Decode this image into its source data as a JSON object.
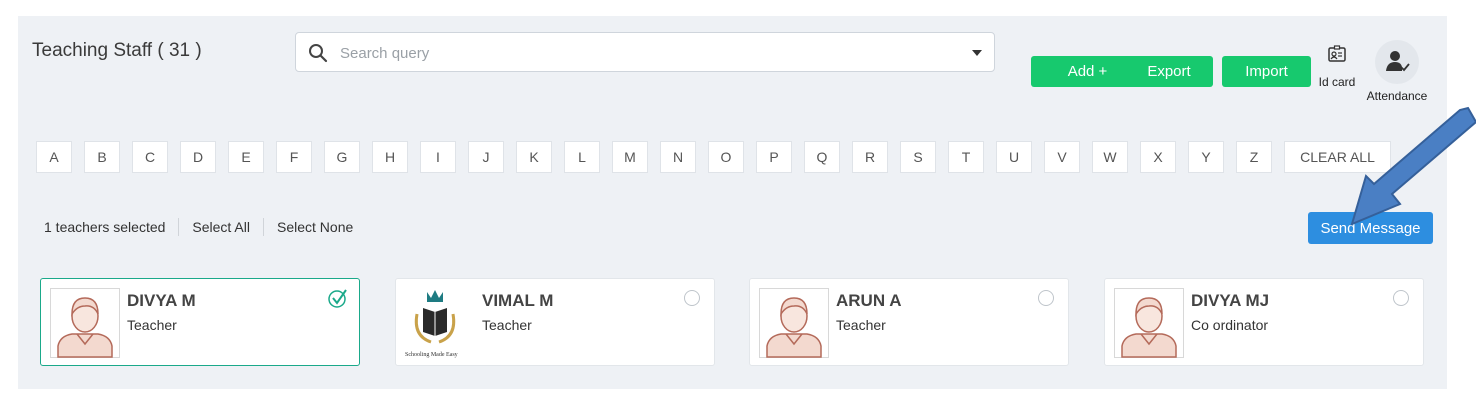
{
  "header": {
    "title": "Teaching Staff ( 31 )",
    "search_placeholder": "Search query",
    "buttons": {
      "add": "Add +",
      "export": "Export",
      "import": "Import"
    },
    "tools": {
      "id_card": "Id card",
      "attendance": "Attendance"
    }
  },
  "alphabet": [
    "A",
    "B",
    "C",
    "D",
    "E",
    "F",
    "G",
    "H",
    "I",
    "J",
    "K",
    "L",
    "M",
    "N",
    "O",
    "P",
    "Q",
    "R",
    "S",
    "T",
    "U",
    "V",
    "W",
    "X",
    "Y",
    "Z"
  ],
  "clear_all": "CLEAR ALL",
  "selection": {
    "count_text": "1 teachers selected",
    "select_all": "Select All",
    "select_none": "Select None",
    "send_message": "Send Message"
  },
  "staff": [
    {
      "name": "DIVYA M",
      "role": "Teacher",
      "selected": true,
      "avatar": "person-avatar"
    },
    {
      "name": "VIMAL M",
      "role": "Teacher",
      "selected": false,
      "avatar": "school-logo",
      "logo_text": "Schooling Made Easy"
    },
    {
      "name": "ARUN A",
      "role": "Teacher",
      "selected": false,
      "avatar": "person-avatar"
    },
    {
      "name": "DIVYA MJ",
      "role": "Co ordinator",
      "selected": false,
      "avatar": "person-avatar"
    }
  ],
  "colors": {
    "green": "#17c96e",
    "blue": "#2d8ee0",
    "arrow": "#4a7fc4",
    "selected_border": "#1aa98a",
    "panel_bg": "#eef1f5"
  }
}
